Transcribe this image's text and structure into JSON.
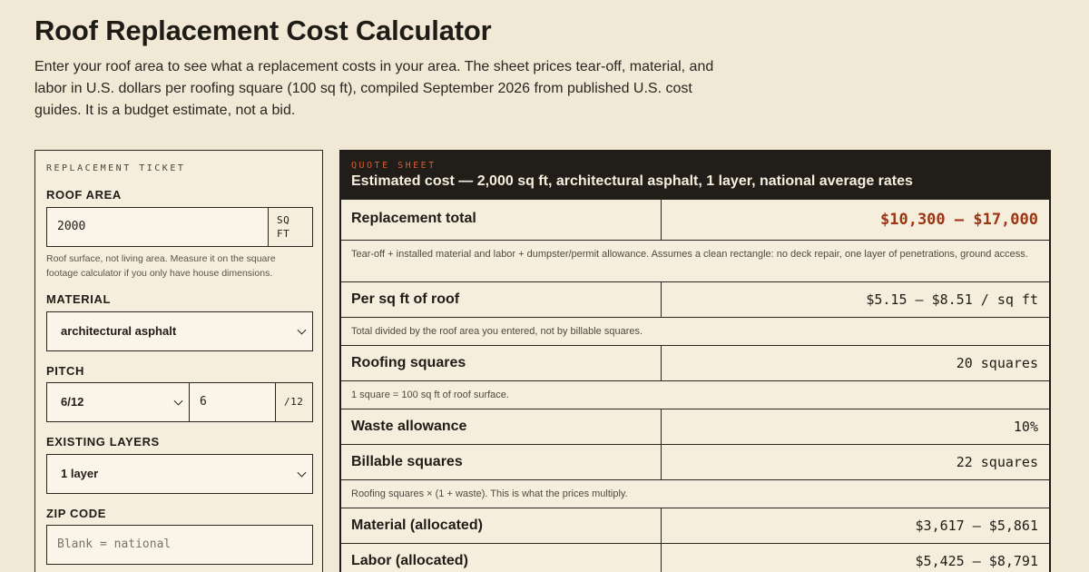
{
  "page": {
    "title": "Roof Replacement Cost Calculator",
    "intro": "Enter your roof area to see what a replacement costs in your area. The sheet prices tear-off, material, and labor in U.S. dollars per roofing square (100 sq ft), compiled September 2026 from published U.S. cost guides. It is a budget estimate, not a bid."
  },
  "ticket": {
    "label": "REPLACEMENT TICKET",
    "roof_area": {
      "label": "ROOF AREA",
      "value": "2000",
      "unit_line1": "SQ",
      "unit_line2": "FT",
      "help": "Roof surface, not living area. Measure it on the square footage calculator if you only have house dimensions."
    },
    "material": {
      "label": "MATERIAL",
      "selected": "architectural asphalt"
    },
    "pitch": {
      "label": "PITCH",
      "selected": "6/12",
      "rise_value": "6",
      "unit": "/12"
    },
    "existing_layers": {
      "label": "EXISTING LAYERS",
      "selected": "1 layer"
    },
    "zip": {
      "label": "ZIP CODE",
      "placeholder": "Blank = national"
    }
  },
  "sheet": {
    "kicker": "QUOTE SHEET",
    "title": "Estimated cost — 2,000 sq ft, architectural asphalt, 1 layer, national average rates",
    "rows": [
      {
        "label": "Replacement total",
        "value": "$10,300 – $17,000"
      },
      {
        "note": "Tear-off + installed material and labor + dumpster/permit allowance. Assumes a clean rectangle: no deck repair, one layer of penetrations, ground access."
      },
      {
        "label": "Per sq ft of roof",
        "value": "$5.15 – $8.51 / sq ft"
      },
      {
        "note": "Total divided by the roof area you entered, not by billable squares."
      },
      {
        "label": "Roofing squares",
        "value": "20 squares"
      },
      {
        "note": "1 square = 100 sq ft of roof surface."
      },
      {
        "label": "Waste allowance",
        "value": "10%"
      },
      {
        "label": "Billable squares",
        "value": "22 squares"
      },
      {
        "note": "Roofing squares × (1 + waste). This is what the prices multiply."
      },
      {
        "label": "Material (allocated)",
        "value": "$3,617 – $5,861"
      },
      {
        "label": "Labor (allocated)",
        "value": "$5,425 – $8,791"
      }
    ]
  },
  "colors": {
    "background": "#f1e8d6",
    "panel": "#f6eedd",
    "ink": "#1f1c17",
    "header_dark": "#211e19",
    "accent_orange": "#d95a32",
    "total_red": "#9c3512"
  }
}
